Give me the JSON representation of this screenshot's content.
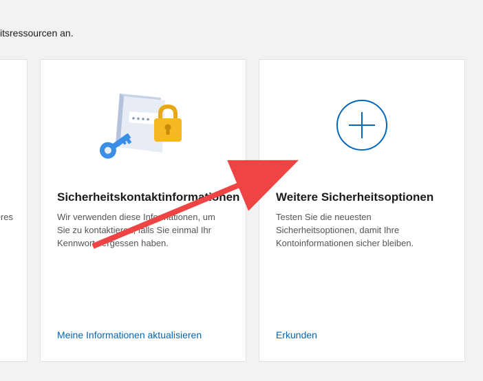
{
  "header": {
    "fragment_text": "itsressourcen an."
  },
  "cards": {
    "partial": {
      "desc_fragment": "keres"
    },
    "security_contact": {
      "title": "Sicherheitskontaktinformationen",
      "desc": "Wir verwenden diese Informationen, um Sie zu kontaktieren, falls Sie einmal Ihr Kennwort vergessen haben.",
      "link_label": "Meine Informationen aktualisieren"
    },
    "more_options": {
      "title": "Weitere Sicherheitsoptionen",
      "desc": "Testen Sie die neuesten Sicherheitsoptionen, damit Ihre Kontoinformationen sicher bleiben.",
      "link_label": "Erkunden"
    }
  }
}
